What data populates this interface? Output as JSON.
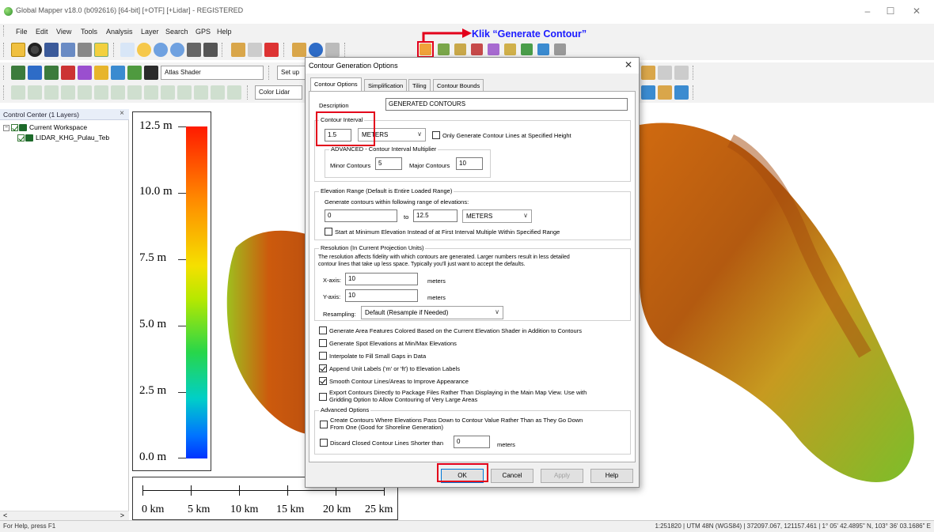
{
  "window": {
    "title": "Global Mapper v18.0 (b092616) [64-bit] [+OTF] [+Lidar] - REGISTERED",
    "controls": {
      "minimize": "–",
      "maximize": "☐",
      "close": "✕"
    }
  },
  "menu": [
    "File",
    "Edit",
    "View",
    "Tools",
    "Analysis",
    "Layer",
    "Search",
    "GPS",
    "Help"
  ],
  "toolbar": {
    "shader_combo": "Atlas Shader",
    "setup_combo": "Set up",
    "lidar_combo": "Color Lidar"
  },
  "annotation": {
    "text": "Klik “Generate Contour”",
    "color": "#1b1bff",
    "highlight_color": "#e3001b"
  },
  "control_center": {
    "title": "Control Center (1 Layers)",
    "close": "×",
    "workspace": "Current Workspace",
    "layer": "LIDAR_KHG_Pulau_Teb",
    "scroll_left": "<",
    "scroll_right": ">"
  },
  "legend": {
    "labels": [
      "12.5 m",
      "10.0 m",
      "7.5 m",
      "5.0 m",
      "2.5 m",
      "0.0 m"
    ]
  },
  "scale_bar": {
    "labels": [
      "0 km",
      "5 km",
      "10 km",
      "15 km",
      "20 km",
      "25 km"
    ]
  },
  "status": {
    "left": "For Help, press F1",
    "right": "1:251820 | UTM 48N (WGS84) | 372097.067, 121157.461 | 1° 05' 42.4895\" N, 103° 36' 03.1686\" E"
  },
  "dialog": {
    "title": "Contour Generation Options",
    "close": "✕",
    "tabs": [
      "Contour Options",
      "Simplification",
      "Tiling",
      "Contour Bounds"
    ],
    "description_label": "Description",
    "description_value": "GENERATED CONTOURS",
    "interval": {
      "title": "Contour Interval",
      "value": "1.5",
      "unit": "METERS",
      "only_specified_label": "Only Generate Contour Lines at Specified Height",
      "advanced_title": "ADVANCED - Contour Interval Multiplier",
      "minor_label": "Minor Contours",
      "minor_value": "5",
      "major_label": "Major Contours",
      "major_value": "10"
    },
    "elevation": {
      "title": "Elevation Range (Default is Entire Loaded Range)",
      "desc": "Generate contours within following range of elevations:",
      "from": "0",
      "to_label": "to",
      "to": "12.5",
      "unit": "METERS",
      "start_min_label": "Start at Minimum Elevation Instead of at First Interval Multiple Within Specified Range"
    },
    "resolution": {
      "title": "Resolution (In Current Projection Units)",
      "desc1": "The resolution affects fidelity with which contours are generated. Larger numbers result in less detailed",
      "desc2": "contour lines that take up less space. Typically you'll just want to accept the defaults.",
      "x_label": "X-axis:",
      "x_value": "10",
      "x_unit": "meters",
      "y_label": "Y-axis:",
      "y_value": "10",
      "y_unit": "meters",
      "resampling_label": "Resampling:",
      "resampling_value": "Default (Resample if Needed)"
    },
    "options": [
      {
        "label": "Generate Area Features Colored Based on the Current Elevation Shader in Addition to Contours",
        "checked": false
      },
      {
        "label": "Generate Spot Elevations at Min/Max Elevations",
        "checked": false
      },
      {
        "label": "Interpolate to Fill Small Gaps in Data",
        "checked": false
      },
      {
        "label": "Append Unit Labels ('m' or 'ft') to Elevation Labels",
        "checked": true
      },
      {
        "label": "Smooth Contour Lines/Areas to Improve Appearance",
        "checked": true
      }
    ],
    "export_label_1": "Export Contours Directly to Package Files Rather Than Displaying in the Main Map View. Use with",
    "export_label_2": "Gridding Option to Allow Contouring of Very Large Areas",
    "advanced": {
      "title": "Advanced Options",
      "create_label_1": "Create Contours Where Elevations Pass Down to Contour Value Rather Than as They Go Down",
      "create_label_2": "From One (Good for Shoreline Generation)",
      "discard_label": "Discard Closed Contour Lines Shorter than",
      "discard_value": "0",
      "discard_unit": "meters"
    },
    "buttons": {
      "ok": "OK",
      "cancel": "Cancel",
      "apply": "Apply",
      "help": "Help"
    }
  }
}
